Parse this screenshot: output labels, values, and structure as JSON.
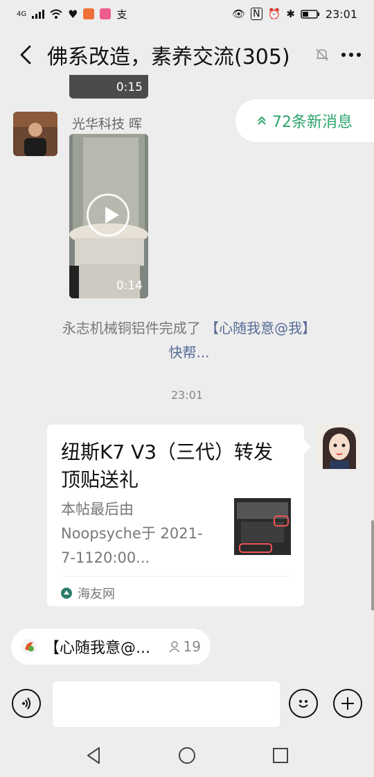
{
  "status_bar": {
    "time": "23:01",
    "network": "4G",
    "cast_label": "支"
  },
  "header": {
    "title": "佛系改造，素养交流(305)"
  },
  "new_messages": {
    "label": "72条新消息"
  },
  "messages": {
    "video_top": {
      "duration": "0:15"
    },
    "video_msg": {
      "sender": "光华科技   晖",
      "duration": "0:14"
    },
    "system": {
      "text": "永志机械铜铝件完成了 ",
      "highlight": "【心随我意@我】",
      "suffix": "快帮..."
    },
    "timestamp": "23:01",
    "card": {
      "title": "纽斯K7 V3（三代）转发顶贴送礼",
      "desc": "本帖最后由 Noopsyche于 2021-7-1120:00...",
      "source": "海友网"
    }
  },
  "quote": {
    "text": "【心随我意@...",
    "count": "19"
  },
  "colors": {
    "accent_green": "#2aa56b",
    "link_blue": "#576b95",
    "chat_bg": "#ededed"
  },
  "icons": [
    "back-icon",
    "mute-icon",
    "more-icon",
    "double-up-chevron-icon",
    "voice-icon",
    "emoji-icon",
    "plus-icon",
    "nav-back-icon",
    "nav-home-icon",
    "nav-recents-icon",
    "person-icon"
  ]
}
